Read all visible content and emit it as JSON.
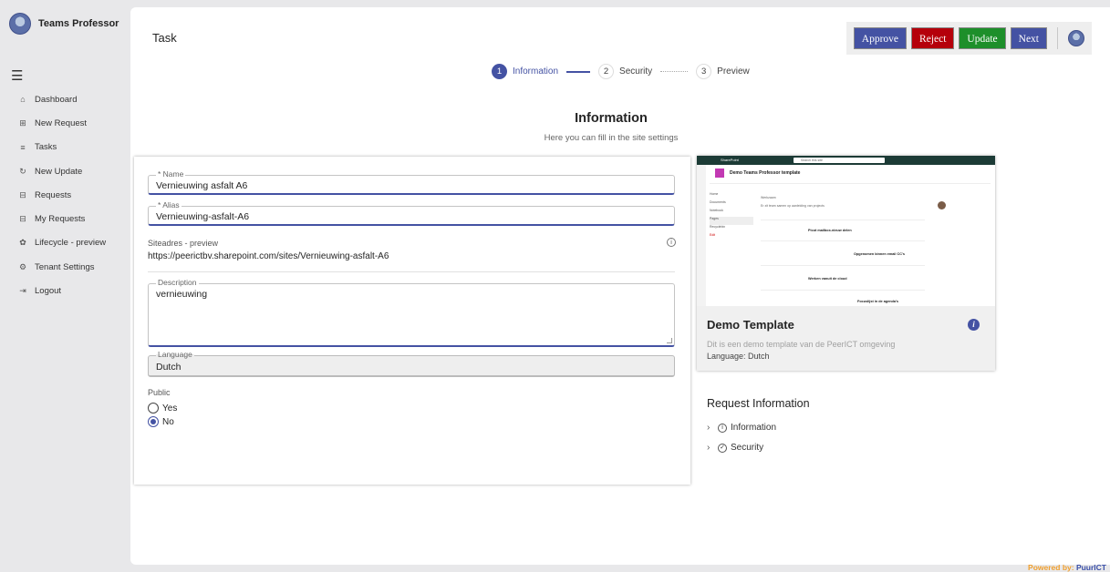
{
  "app": {
    "name": "Teams Professor"
  },
  "sidebar": {
    "items": [
      {
        "label": "Dashboard",
        "icon": "home-icon"
      },
      {
        "label": "New Request",
        "icon": "new-request-icon"
      },
      {
        "label": "Tasks",
        "icon": "tasks-icon"
      },
      {
        "label": "New Update",
        "icon": "refresh-icon"
      },
      {
        "label": "Requests",
        "icon": "requests-icon"
      },
      {
        "label": "My Requests",
        "icon": "my-requests-icon"
      },
      {
        "label": "Lifecycle - preview",
        "icon": "lifecycle-icon"
      },
      {
        "label": "Tenant Settings",
        "icon": "settings-icon"
      },
      {
        "label": "Logout",
        "icon": "logout-icon"
      }
    ]
  },
  "page": {
    "title": "Task"
  },
  "toolbar": {
    "approve": "Approve",
    "reject": "Reject",
    "update": "Update",
    "next": "Next"
  },
  "stepper": {
    "steps": [
      {
        "num": "1",
        "label": "Information"
      },
      {
        "num": "2",
        "label": "Security"
      },
      {
        "num": "3",
        "label": "Preview"
      }
    ]
  },
  "section": {
    "title": "Information",
    "subtitle": "Here you can fill in the site settings"
  },
  "form": {
    "name": {
      "label": "* Name",
      "value": "Vernieuwing asfalt A6"
    },
    "alias": {
      "label": "* Alias",
      "value": "Vernieuwing-asfalt-A6"
    },
    "site": {
      "label": "Siteadres - preview",
      "value": "https://peerictbv.sharepoint.com/sites/Vernieuwing-asfalt-A6"
    },
    "description": {
      "label": "Description",
      "value": "vernieuwing"
    },
    "language": {
      "label": "Language",
      "value": "Dutch"
    },
    "public": {
      "label": "Public",
      "yes": "Yes",
      "no": "No",
      "selected": "No"
    }
  },
  "template": {
    "name": "Demo Template",
    "description": "Dit is een demo template van de PeerICT omgeving",
    "language": "Language: Dutch",
    "preview": {
      "brand": "SharePoint",
      "search": "Search this site",
      "site_title": "Demo Teams Professor template",
      "nav": [
        "Home",
        "Documents",
        "Notebook",
        "Pages",
        "Recyclebin",
        "Edit"
      ],
      "heading": "Werkzaam",
      "text": "Er zit team samen op aanleiding van projects",
      "items": [
        "Picot mailbox-nieuw delen",
        "Opgenomen binnen email CC's",
        "Werken vanuit de cloud",
        "Focuslijst in de agenda's"
      ]
    }
  },
  "request_info": {
    "title": "Request Information",
    "items": [
      {
        "label": "Information"
      },
      {
        "label": "Security"
      }
    ]
  },
  "footer": {
    "powered_prefix": "Powered by: ",
    "powered_brand": "PuurICT"
  },
  "colors": {
    "primary": "#4452a3",
    "reject": "#b5000b",
    "update": "#1d8f2a"
  }
}
